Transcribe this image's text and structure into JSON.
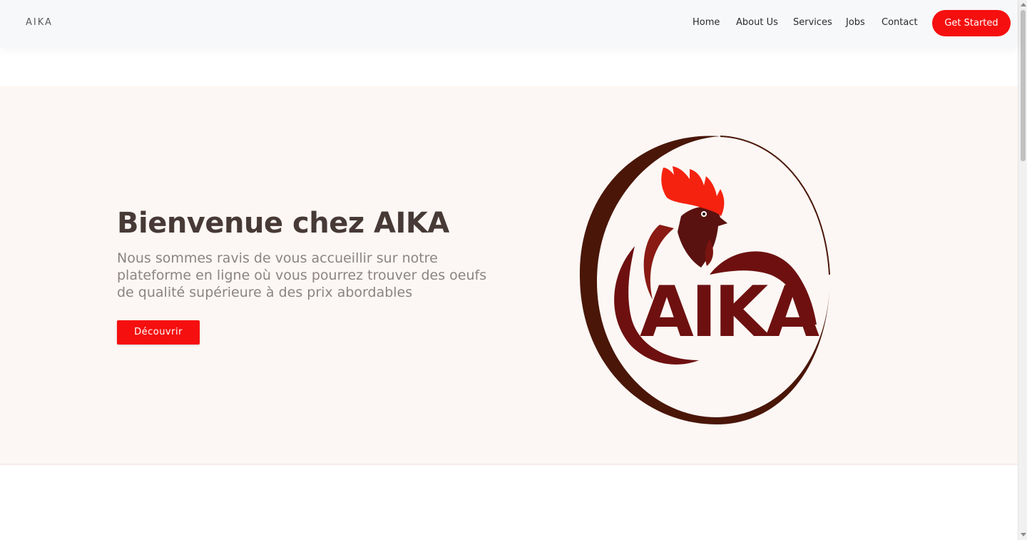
{
  "header": {
    "brand": "AIKA",
    "nav": [
      {
        "label": "Home"
      },
      {
        "label": "About Us"
      },
      {
        "label": "Services"
      },
      {
        "label": "Jobs"
      },
      {
        "label": "Contact"
      }
    ],
    "cta_label": "Get Started"
  },
  "hero": {
    "title": "Bienvenue chez AIKA",
    "subtitle": "Nous sommes ravis de vous accueillir sur notre plateforme en ligne où vous pourrez trouver des oeufs de qualité supérieure à des prix abordables",
    "button_label": "Découvrir",
    "logo": {
      "icon": "rooster-logo",
      "text": "AIKA",
      "colors": {
        "ring": "#4a1608",
        "crest": "#f5220f",
        "letters": "#6e1010",
        "head": "#5a1210"
      }
    }
  },
  "colors": {
    "accent": "#f50f0f",
    "hero_background": "#fcf7f4",
    "header_background": "#f7f8fa",
    "title": "#473a36",
    "subtitle": "#8b8482"
  }
}
